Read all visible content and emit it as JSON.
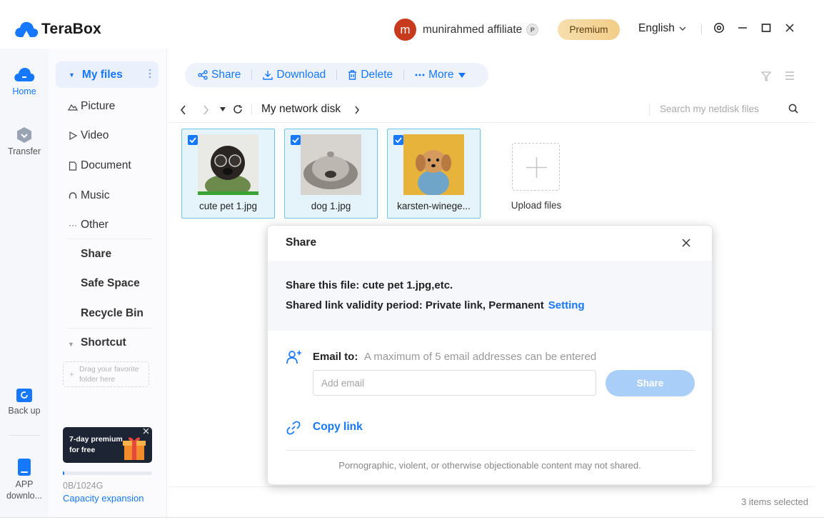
{
  "app": {
    "name": "TeraBox"
  },
  "header": {
    "avatar_letter": "m",
    "username": "munirahmed affiliate",
    "badge_letter": "P",
    "premium_label": "Premium",
    "language": "English"
  },
  "rail": {
    "home": "Home",
    "transfer": "Transfer",
    "backup": "Back up",
    "app_download_1": "APP",
    "app_download_2": "downlo..."
  },
  "sidebar": {
    "my_files": "My files",
    "items": [
      "Picture",
      "Video",
      "Document",
      "Music",
      "Other"
    ],
    "share": "Share",
    "safe_space": "Safe Space",
    "recycle_bin": "Recycle Bin",
    "shortcut": "Shortcut",
    "drag_hint_1": "Drag your favorite",
    "drag_hint_2": "folder here",
    "promo_1": "7-day premium",
    "promo_2": "for free",
    "capacity_fraction": 0.0,
    "capacity_text": "0B/1024G",
    "capacity_link": "Capacity expansion"
  },
  "toolbar": {
    "share": "Share",
    "download": "Download",
    "delete": "Delete",
    "more": "More"
  },
  "path": {
    "current": "My network disk",
    "search_placeholder": "Search my netdisk files"
  },
  "files": [
    {
      "name": "cute pet 1.jpg",
      "checked": true
    },
    {
      "name": "dog 1.jpg",
      "checked": true
    },
    {
      "name": "karsten-winege...",
      "checked": true
    }
  ],
  "upload_label": "Upload files",
  "status": {
    "selected": "3 items selected"
  },
  "dialog": {
    "title": "Share",
    "file_line": "Share this file: cute pet 1.jpg,etc.",
    "validity_line": "Shared link validity period: Private link, Permanent",
    "setting_link": "Setting",
    "email_label": "Email to:",
    "email_hint": "A maximum of 5 email addresses can be entered",
    "email_placeholder": "Add email",
    "share_button": "Share",
    "copy_link": "Copy link",
    "footer": "Pornographic, violent, or otherwise objectionable content may not shared."
  },
  "colors": {
    "accent": "#1677ff",
    "premium": "#f2cd88",
    "avatar": "#c83a1d",
    "share_button_disabled": "#a9cff8"
  }
}
